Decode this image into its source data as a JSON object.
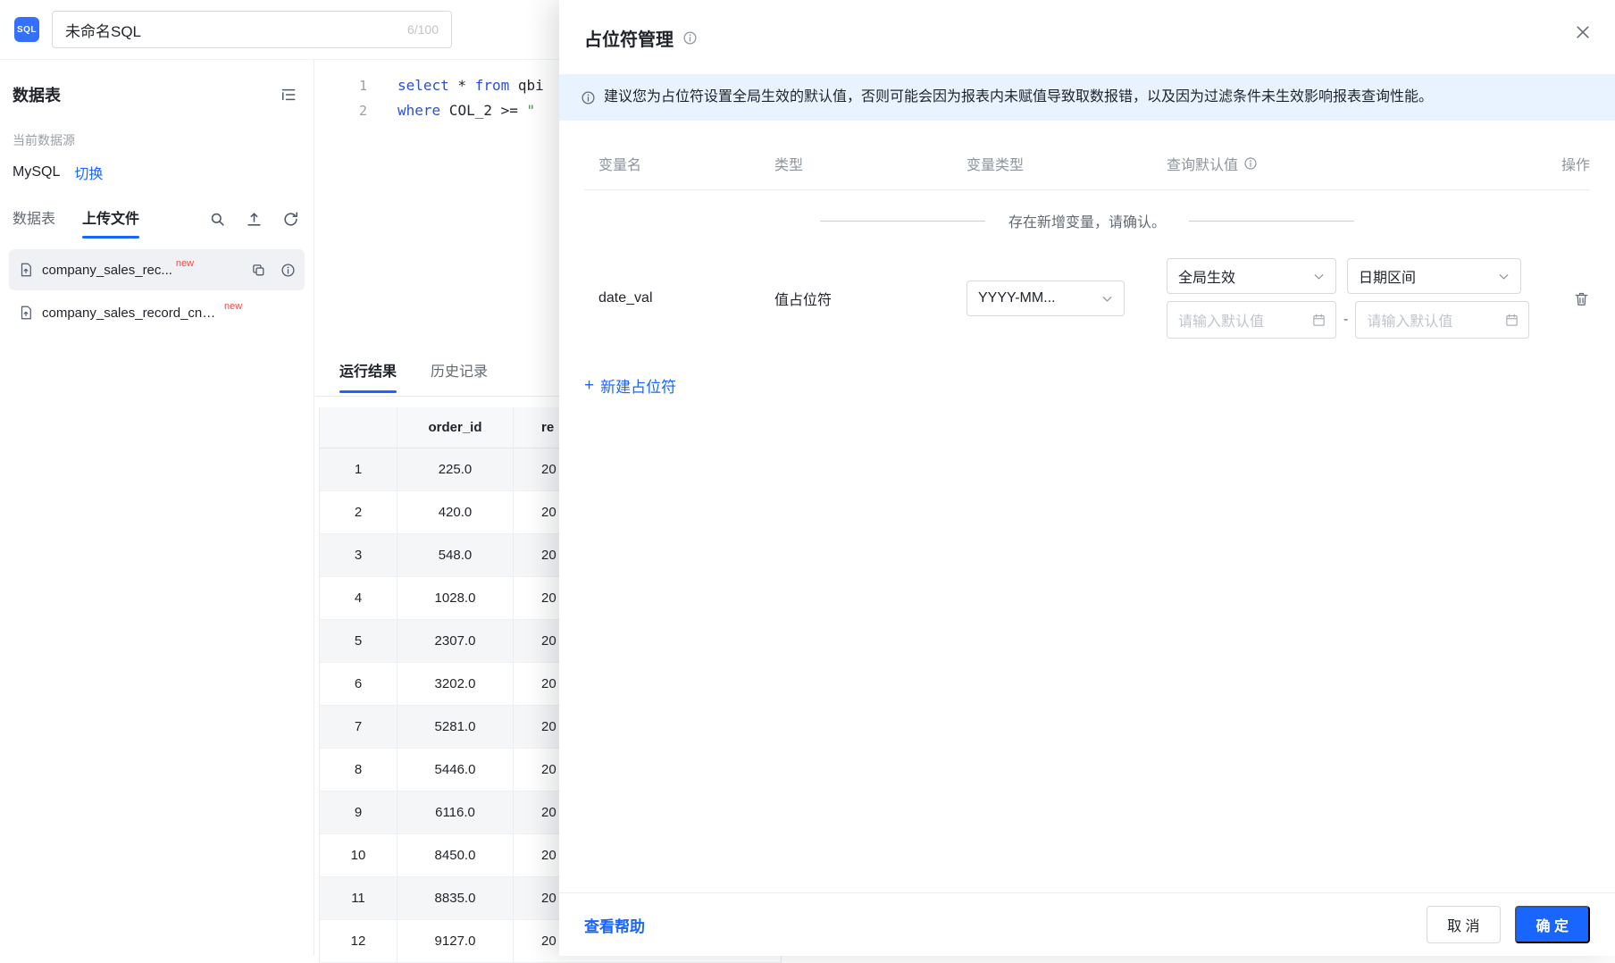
{
  "colors": {
    "primary": "#1966ff",
    "banner_bg": "#e9f2ff",
    "badge": "#f54a45",
    "logo": "#3370ff"
  },
  "topbar": {
    "logo": "SQL",
    "title": "未命名SQL",
    "counter": "6/100"
  },
  "sidebar": {
    "title": "数据表",
    "datasource_label": "当前数据源",
    "datasource_name": "MySQL",
    "switch_label": "切换",
    "tabs": [
      {
        "label": "数据表",
        "active": false
      },
      {
        "label": "上传文件",
        "active": true
      }
    ],
    "tools": [
      "search-icon",
      "upload-icon",
      "refresh-icon"
    ],
    "files": [
      {
        "name": "company_sales_rec...",
        "badge": "new",
        "selected": true
      },
      {
        "name": "company_sales_record_cn_...",
        "badge": "new",
        "selected": false
      }
    ]
  },
  "editor": {
    "lines": [
      {
        "no": "1",
        "tokens": [
          {
            "t": "select",
            "c": "kw"
          },
          {
            "t": " * ",
            "c": "plain"
          },
          {
            "t": "from",
            "c": "kw"
          },
          {
            "t": " qbi",
            "c": "plain"
          }
        ]
      },
      {
        "no": "2",
        "tokens": [
          {
            "t": "where",
            "c": "kw"
          },
          {
            "t": " COL_2 ",
            "c": "plain"
          },
          {
            "t": ">=",
            "c": "op"
          },
          {
            "t": " \"",
            "c": "str"
          }
        ]
      }
    ]
  },
  "results": {
    "tabs": [
      {
        "label": "运行结果",
        "active": true
      },
      {
        "label": "历史记录",
        "active": false
      }
    ],
    "columns": [
      "",
      "order_id",
      "re"
    ],
    "rows": [
      [
        "1",
        "225.0",
        "20"
      ],
      [
        "2",
        "420.0",
        "20"
      ],
      [
        "3",
        "548.0",
        "20"
      ],
      [
        "4",
        "1028.0",
        "20"
      ],
      [
        "5",
        "2307.0",
        "20"
      ],
      [
        "6",
        "3202.0",
        "20"
      ],
      [
        "7",
        "5281.0",
        "20"
      ],
      [
        "8",
        "5446.0",
        "20"
      ],
      [
        "9",
        "6116.0",
        "20"
      ],
      [
        "10",
        "8450.0",
        "20"
      ],
      [
        "11",
        "8835.0",
        "20"
      ],
      [
        "12",
        "9127.0",
        "20"
      ]
    ]
  },
  "modal": {
    "title": "占位符管理",
    "banner": "建议您为占位符设置全局生效的默认值，否则可能会因为报表内未赋值导致取数报错，以及因为过滤条件未生效影响报表查询性能。",
    "table_headers": [
      "变量名",
      "类型",
      "变量类型",
      "查询默认值",
      "操作"
    ],
    "notice": "存在新增变量，请确认。",
    "row": {
      "name": "date_val",
      "type": "值占位符",
      "format": "YYYY-MM...",
      "scope": "全局生效",
      "var_type": "日期区间",
      "placeholder_start": "请输入默认值",
      "range_separator": "-",
      "placeholder_end": "请输入默认值"
    },
    "add_label": "新建占位符",
    "help_label": "查看帮助",
    "cancel_label": "取 消",
    "confirm_label": "确 定"
  }
}
